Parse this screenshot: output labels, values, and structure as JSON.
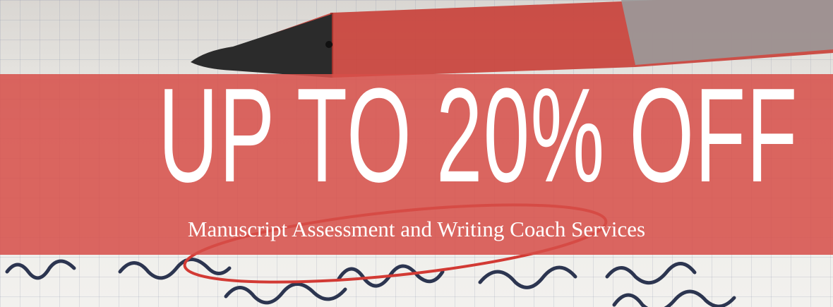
{
  "promo": {
    "headline": "UP TO 20% OFF",
    "subline": "Manuscript Assessment and Writing Coach Services"
  },
  "background": {
    "description_icon": "red-pen-on-handwritten-notes-photo",
    "band_color": "#d64e48",
    "pen_color": "#c9473f"
  }
}
